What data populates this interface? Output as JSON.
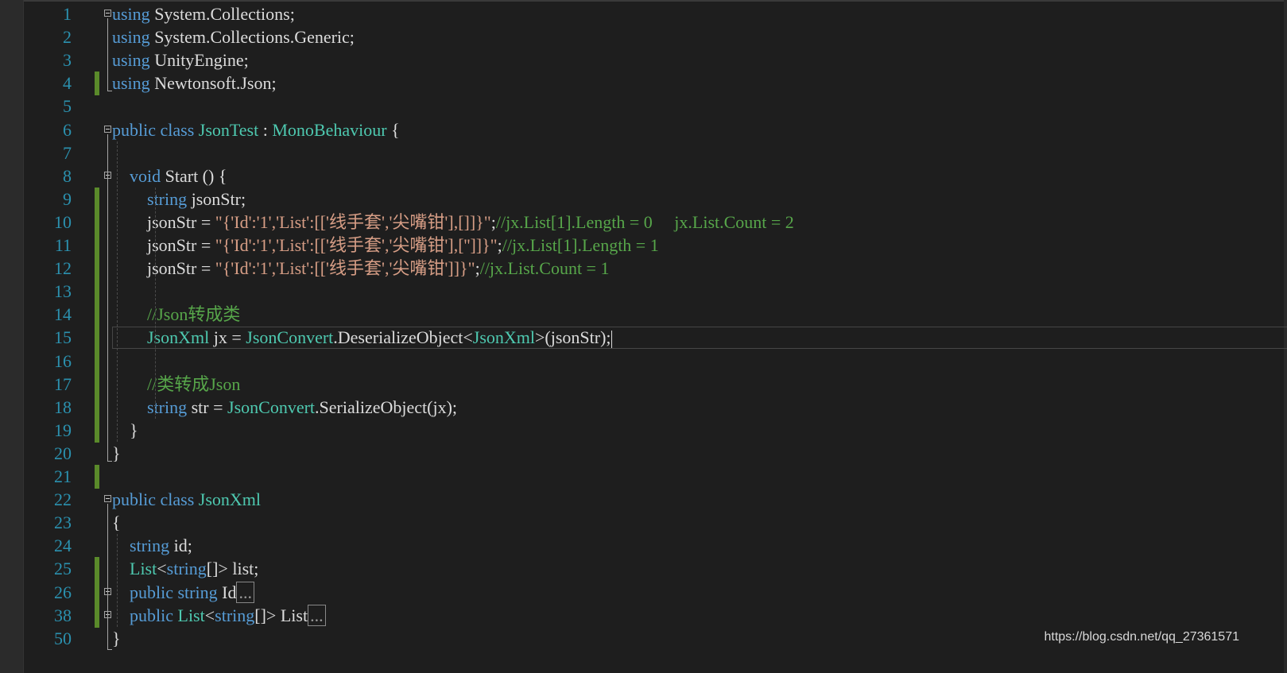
{
  "editor": {
    "lines": [
      {
        "num": "1",
        "t": [
          {
            "s": "using",
            "c": "kw"
          },
          {
            "s": " System.Collections;",
            "c": ""
          }
        ]
      },
      {
        "num": "2",
        "t": [
          {
            "s": "using",
            "c": "kw"
          },
          {
            "s": " System.Collections.Generic;",
            "c": ""
          }
        ]
      },
      {
        "num": "3",
        "t": [
          {
            "s": "using",
            "c": "kw"
          },
          {
            "s": " UnityEngine;",
            "c": ""
          }
        ]
      },
      {
        "num": "4",
        "t": [
          {
            "s": "using",
            "c": "kw"
          },
          {
            "s": " Newtonsoft.Json;",
            "c": ""
          }
        ]
      },
      {
        "num": "5",
        "t": []
      },
      {
        "num": "6",
        "t": [
          {
            "s": "public",
            "c": "kw"
          },
          {
            "s": " ",
            "c": ""
          },
          {
            "s": "class",
            "c": "kw"
          },
          {
            "s": " ",
            "c": ""
          },
          {
            "s": "JsonTest",
            "c": "ty"
          },
          {
            "s": " : ",
            "c": ""
          },
          {
            "s": "MonoBehaviour",
            "c": "ty"
          },
          {
            "s": " {",
            "c": ""
          }
        ]
      },
      {
        "num": "7",
        "t": []
      },
      {
        "num": "8",
        "t": [
          {
            "s": "    ",
            "c": ""
          },
          {
            "s": "void",
            "c": "kw"
          },
          {
            "s": " Start () {",
            "c": ""
          }
        ]
      },
      {
        "num": "9",
        "t": [
          {
            "s": "        ",
            "c": ""
          },
          {
            "s": "string",
            "c": "kw"
          },
          {
            "s": " jsonStr;",
            "c": ""
          }
        ]
      },
      {
        "num": "10",
        "t": [
          {
            "s": "        jsonStr = ",
            "c": ""
          },
          {
            "s": "\"{'Id':'1','List':[['线手套','尖嘴钳'],[]]}\"",
            "c": "str"
          },
          {
            "s": ";",
            "c": ""
          },
          {
            "s": "//jx.List[1].Length = 0     jx.List.Count = 2",
            "c": "cm"
          }
        ]
      },
      {
        "num": "11",
        "t": [
          {
            "s": "        jsonStr = ",
            "c": ""
          },
          {
            "s": "\"{'Id':'1','List':[['线手套','尖嘴钳'],['']]}\"",
            "c": "str"
          },
          {
            "s": ";",
            "c": ""
          },
          {
            "s": "//jx.List[1].Length = 1",
            "c": "cm"
          }
        ]
      },
      {
        "num": "12",
        "t": [
          {
            "s": "        jsonStr = ",
            "c": ""
          },
          {
            "s": "\"{'Id':'1','List':[['线手套','尖嘴钳']]}\"",
            "c": "str"
          },
          {
            "s": ";",
            "c": ""
          },
          {
            "s": "//jx.List.Count = 1",
            "c": "cm"
          }
        ]
      },
      {
        "num": "13",
        "t": []
      },
      {
        "num": "14",
        "t": [
          {
            "s": "        ",
            "c": ""
          },
          {
            "s": "//Json转成类",
            "c": "cm"
          }
        ]
      },
      {
        "num": "15",
        "t": [
          {
            "s": "        ",
            "c": ""
          },
          {
            "s": "JsonXml",
            "c": "ty"
          },
          {
            "s": " jx = ",
            "c": ""
          },
          {
            "s": "JsonConvert",
            "c": "ty"
          },
          {
            "s": ".DeserializeObject<",
            "c": ""
          },
          {
            "s": "JsonXml",
            "c": "ty"
          },
          {
            "s": ">(jsonStr);",
            "c": ""
          }
        ]
      },
      {
        "num": "16",
        "t": []
      },
      {
        "num": "17",
        "t": [
          {
            "s": "        ",
            "c": ""
          },
          {
            "s": "//类转成Json",
            "c": "cm"
          }
        ]
      },
      {
        "num": "18",
        "t": [
          {
            "s": "        ",
            "c": ""
          },
          {
            "s": "string",
            "c": "kw"
          },
          {
            "s": " str = ",
            "c": ""
          },
          {
            "s": "JsonConvert",
            "c": "ty"
          },
          {
            "s": ".SerializeObject(jx);",
            "c": ""
          }
        ]
      },
      {
        "num": "19",
        "t": [
          {
            "s": "    }",
            "c": ""
          }
        ]
      },
      {
        "num": "20",
        "t": [
          {
            "s": "}",
            "c": ""
          }
        ]
      },
      {
        "num": "21",
        "t": []
      },
      {
        "num": "22",
        "t": [
          {
            "s": "public",
            "c": "kw"
          },
          {
            "s": " ",
            "c": ""
          },
          {
            "s": "class",
            "c": "kw"
          },
          {
            "s": " ",
            "c": ""
          },
          {
            "s": "JsonXml",
            "c": "ty"
          }
        ]
      },
      {
        "num": "23",
        "t": [
          {
            "s": "{",
            "c": ""
          }
        ]
      },
      {
        "num": "24",
        "t": [
          {
            "s": "    ",
            "c": ""
          },
          {
            "s": "string",
            "c": "kw"
          },
          {
            "s": " id;",
            "c": ""
          }
        ]
      },
      {
        "num": "25",
        "t": [
          {
            "s": "    ",
            "c": ""
          },
          {
            "s": "List",
            "c": "ty"
          },
          {
            "s": "<",
            "c": ""
          },
          {
            "s": "string",
            "c": "kw"
          },
          {
            "s": "[]> list;",
            "c": ""
          }
        ]
      },
      {
        "num": "26",
        "t": [
          {
            "s": "    ",
            "c": ""
          },
          {
            "s": "public",
            "c": "kw"
          },
          {
            "s": " ",
            "c": ""
          },
          {
            "s": "string",
            "c": "kw"
          },
          {
            "s": " Id",
            "c": ""
          },
          {
            "s": "...",
            "c": "collapsed"
          }
        ]
      },
      {
        "num": "38",
        "t": [
          {
            "s": "    ",
            "c": ""
          },
          {
            "s": "public",
            "c": "kw"
          },
          {
            "s": " ",
            "c": ""
          },
          {
            "s": "List",
            "c": "ty"
          },
          {
            "s": "<",
            "c": ""
          },
          {
            "s": "string",
            "c": "kw"
          },
          {
            "s": "[]> List",
            "c": ""
          },
          {
            "s": "...",
            "c": "collapsed"
          }
        ]
      },
      {
        "num": "50",
        "t": [
          {
            "s": "}",
            "c": ""
          }
        ]
      }
    ],
    "changed_lines": [
      "4",
      "9",
      "10",
      "11",
      "12",
      "13",
      "14",
      "15",
      "16",
      "17",
      "18",
      "19",
      "21",
      "25",
      "26",
      "38"
    ],
    "fold_minus_lines": [
      "1",
      "6",
      "8",
      "22"
    ],
    "fold_plus_lines": [
      "26",
      "38"
    ],
    "caret_line": "15",
    "colors": {
      "background": "#1e1e1e",
      "keyword": "#569cd6",
      "type": "#4ec9b0",
      "string": "#d69d85",
      "comment": "#57a64a",
      "line_number": "#2b91af"
    }
  },
  "watermark": "https://blog.csdn.net/qq_27361571"
}
